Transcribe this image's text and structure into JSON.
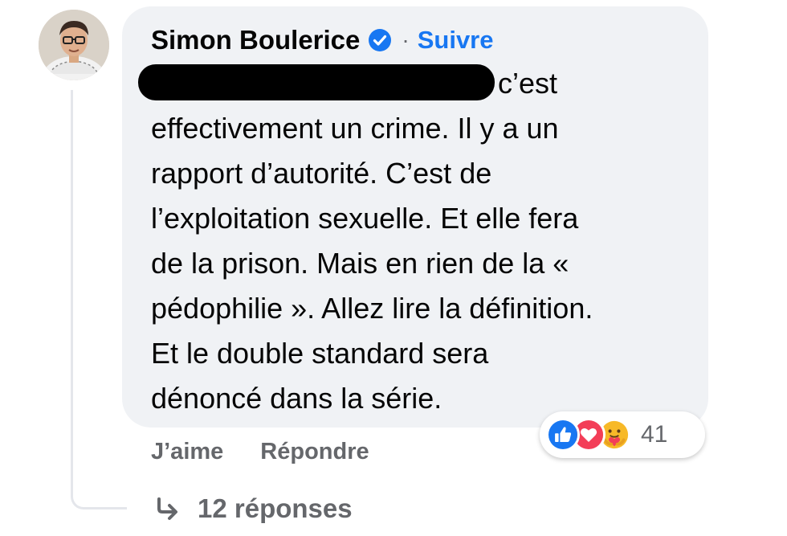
{
  "comment": {
    "author": "Simon Boulerice",
    "follow_separator": "·",
    "follow_label": "Suivre",
    "text_lines": [
      "c’est",
      "effectivement un crime. Il y a un",
      "rapport d’autorité. C’est de",
      "l’exploitation sexuelle. Et elle fera",
      "de la prison. Mais en rien de la «",
      "pédophilie ». Allez lire la définition.",
      "Et le double standard sera",
      "dénoncé dans la série."
    ],
    "reactions": {
      "icons": [
        "like-icon",
        "love-icon",
        "care-icon"
      ],
      "count": "41"
    },
    "actions": {
      "like_label": "J’aime",
      "reply_label": "Répondre"
    },
    "replies_label": "12 réponses"
  },
  "colors": {
    "bubble": "#f0f2f5",
    "link_blue": "#1877f2",
    "secondary_text": "#65676b",
    "love_red": "#f33e58",
    "care_yellow": "#f7b928"
  }
}
